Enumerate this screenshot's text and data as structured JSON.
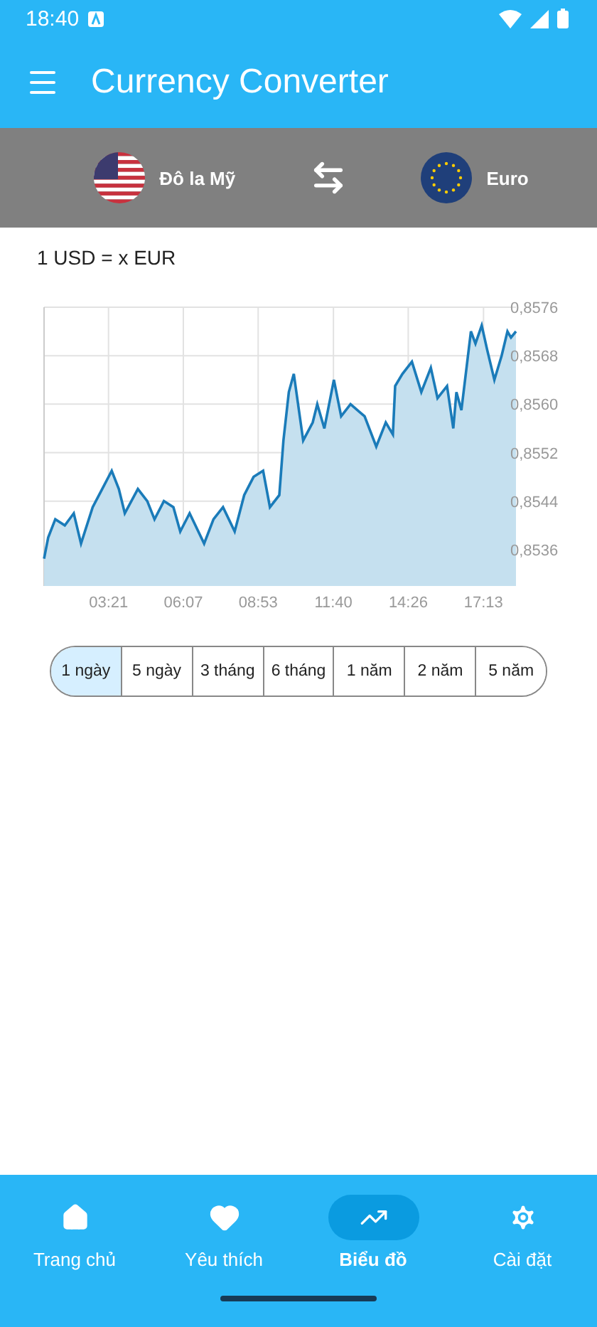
{
  "status_bar": {
    "time": "18:40"
  },
  "app_bar": {
    "title": "Currency Converter"
  },
  "currency_pair": {
    "from": {
      "name": "Đô la Mỹ"
    },
    "to": {
      "name": "Euro"
    }
  },
  "rate_label": "1 USD = x EUR",
  "chart": {
    "chart_data": {
      "type": "area",
      "grid": true,
      "xlim": [
        58,
        1105
      ],
      "ylim": [
        0.853,
        0.8576
      ],
      "xticks": [
        {
          "value": 201,
          "label": "03:21"
        },
        {
          "value": 367,
          "label": "06:07"
        },
        {
          "value": 533,
          "label": "08:53"
        },
        {
          "value": 700,
          "label": "11:40"
        },
        {
          "value": 866,
          "label": "14:26"
        },
        {
          "value": 1033,
          "label": "17:13"
        }
      ],
      "yticks": [
        {
          "value": 0.8536,
          "label": "0,8536"
        },
        {
          "value": 0.8544,
          "label": "0,8544"
        },
        {
          "value": 0.8552,
          "label": "0,8552"
        },
        {
          "value": 0.856,
          "label": "0,8560"
        },
        {
          "value": 0.8568,
          "label": "0,8568"
        },
        {
          "value": 0.8576,
          "label": "0,8576"
        }
      ],
      "x": [
        58,
        67,
        83,
        104,
        124,
        140,
        166,
        187,
        208,
        224,
        237,
        266,
        287,
        303,
        324,
        345,
        360,
        381,
        413,
        434,
        455,
        481,
        502,
        523,
        544,
        559,
        580,
        589,
        601,
        612,
        633,
        654,
        664,
        680,
        701,
        717,
        738,
        769,
        795,
        816,
        832,
        837,
        853,
        874,
        895,
        916,
        931,
        952,
        966,
        973,
        984,
        1005,
        1015,
        1029,
        1041,
        1057,
        1073,
        1086,
        1094,
        1105
      ],
      "series": [
        {
          "color": "#1a7bb9",
          "values": [
            0.85345,
            0.8538,
            0.8541,
            0.854,
            0.8542,
            0.8537,
            0.8543,
            0.8546,
            0.8549,
            0.8546,
            0.8542,
            0.8546,
            0.8544,
            0.8541,
            0.8544,
            0.8543,
            0.8539,
            0.8542,
            0.8537,
            0.8541,
            0.8543,
            0.8539,
            0.8545,
            0.8548,
            0.8549,
            0.8543,
            0.8545,
            0.8554,
            0.8562,
            0.8565,
            0.8554,
            0.8557,
            0.856,
            0.8556,
            0.8564,
            0.8558,
            0.856,
            0.8558,
            0.8553,
            0.8557,
            0.8555,
            0.8563,
            0.8565,
            0.8567,
            0.8562,
            0.8566,
            0.8561,
            0.8563,
            0.8556,
            0.8562,
            0.8559,
            0.8572,
            0.857,
            0.8573,
            0.8569,
            0.8564,
            0.8568,
            0.8572,
            0.8571,
            0.8572
          ]
        }
      ]
    }
  },
  "ranges": [
    {
      "label": "1 ngày",
      "selected": true
    },
    {
      "label": "5 ngày",
      "selected": false
    },
    {
      "label": "3 tháng",
      "selected": false
    },
    {
      "label": "6 tháng",
      "selected": false
    },
    {
      "label": "1 năm",
      "selected": false
    },
    {
      "label": "2 năm",
      "selected": false
    },
    {
      "label": "5 năm",
      "selected": false
    }
  ],
  "bottom_nav": [
    {
      "kind": "home",
      "label": "Trang chủ",
      "selected": false
    },
    {
      "kind": "favorites",
      "label": "Yêu thích",
      "selected": false
    },
    {
      "kind": "chart",
      "label": "Biểu đồ",
      "selected": true
    },
    {
      "kind": "settings",
      "label": "Cài đặt",
      "selected": false
    }
  ]
}
